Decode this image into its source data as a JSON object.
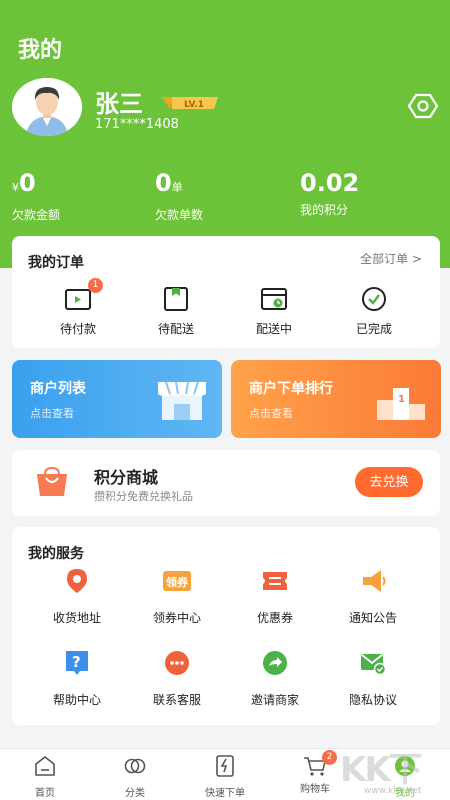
{
  "header": {
    "title": "我的",
    "username": "张三",
    "level": "LV.1",
    "phone": "171****1408",
    "settings_icon": "settings-hex-icon"
  },
  "stats": [
    {
      "prefix": "¥",
      "value": "0",
      "unit": "",
      "label": "欠款金额"
    },
    {
      "prefix": "",
      "value": "0",
      "unit": "单",
      "label": "欠款单数"
    },
    {
      "prefix": "",
      "value": "0.02",
      "unit": "",
      "label": "我的积分"
    }
  ],
  "orders": {
    "title": "我的订单",
    "all_label": "全部订单 >",
    "items": [
      {
        "label": "待付款",
        "icon": "wallet-icon",
        "badge": "1"
      },
      {
        "label": "待配送",
        "icon": "package-icon",
        "badge": ""
      },
      {
        "label": "配送中",
        "icon": "delivery-icon",
        "badge": ""
      },
      {
        "label": "已完成",
        "icon": "check-circle-icon",
        "badge": ""
      }
    ]
  },
  "promos": [
    {
      "title": "商户列表",
      "subtitle": "点击查看",
      "icon": "shop-icon",
      "color": "#3aa0ee"
    },
    {
      "title": "商户下单排行",
      "subtitle": "点击查看",
      "icon": "podium-icon",
      "color": "#fb7a37"
    }
  ],
  "points_mall": {
    "title": "积分商城",
    "subtitle": "攒积分免费兑换礼品",
    "button": "去兑换",
    "icon": "shopping-bag-icon"
  },
  "services": {
    "title": "我的服务",
    "items": [
      {
        "label": "收货地址",
        "icon": "location-icon",
        "color": "#f2613d"
      },
      {
        "label": "领券中心",
        "icon": "coupon-center-icon",
        "color": "#f7a23b"
      },
      {
        "label": "优惠券",
        "icon": "ticket-icon",
        "color": "#f2613d"
      },
      {
        "label": "通知公告",
        "icon": "megaphone-icon",
        "color": "#f7a23b"
      },
      {
        "label": "帮助中心",
        "icon": "help-icon",
        "color": "#3d8fe8"
      },
      {
        "label": "联系客服",
        "icon": "chat-icon",
        "color": "#f2613d"
      },
      {
        "label": "邀请商家",
        "icon": "share-icon",
        "color": "#4db14a"
      },
      {
        "label": "隐私协议",
        "icon": "privacy-mail-icon",
        "color": "#4db14a"
      }
    ]
  },
  "tabbar": {
    "items": [
      {
        "label": "首页",
        "icon": "home-icon",
        "active": false
      },
      {
        "label": "分类",
        "icon": "category-icon",
        "active": false
      },
      {
        "label": "快速下单",
        "icon": "quick-order-icon",
        "active": false
      },
      {
        "label": "购物车",
        "icon": "cart-icon",
        "active": false,
        "badge": "2"
      },
      {
        "label": "我的",
        "icon": "profile-icon",
        "active": true
      }
    ]
  },
  "colors": {
    "brand": "#6cc33a",
    "accent_orange": "#ff6a2f",
    "badge_red": "#f56c4a"
  },
  "watermark": {
    "text": "KK下载",
    "url": "www.kkx.net"
  }
}
